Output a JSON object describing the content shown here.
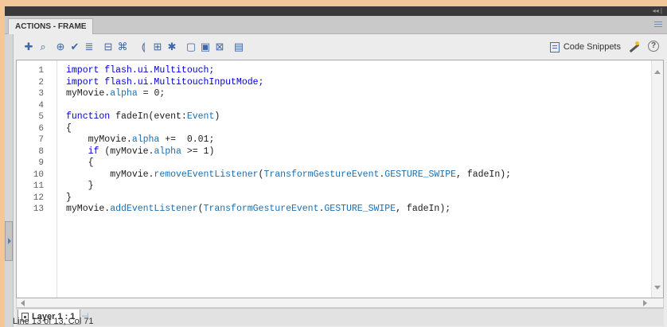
{
  "panel": {
    "tab_label": "ACTIONS - FRAME",
    "collapse_label": "◂◂ |"
  },
  "toolbar": {
    "icons": [
      "add-statement-icon",
      "find-icon",
      "target-path-icon",
      "check-syntax-icon",
      "auto-format-icon",
      "show-code-hint-icon",
      "debug-options-icon",
      "collapse-between-braces-icon",
      "collapse-selection-icon",
      "expand-all-icon",
      "apply-block-comment-icon",
      "apply-line-comment-icon",
      "remove-comment-icon",
      "show-hide-toolbox-icon"
    ],
    "code_snippets_label": "Code Snippets",
    "help_label": "?"
  },
  "editor": {
    "lines": [
      {
        "num": "1",
        "tokens": [
          {
            "t": "import flash.ui.Multitouch;",
            "c": "kw"
          }
        ]
      },
      {
        "num": "2",
        "tokens": [
          {
            "t": "import flash.ui.MultitouchInputMode;",
            "c": "kw"
          }
        ]
      },
      {
        "num": "3",
        "tokens": [
          {
            "t": "myMovie.",
            "c": "plain"
          },
          {
            "t": "alpha",
            "c": "fn"
          },
          {
            "t": " = 0;",
            "c": "plain"
          }
        ]
      },
      {
        "num": "4",
        "tokens": []
      },
      {
        "num": "5",
        "tokens": [
          {
            "t": "function",
            "c": "kw"
          },
          {
            "t": " fadeIn(event:",
            "c": "plain"
          },
          {
            "t": "Event",
            "c": "cls"
          },
          {
            "t": ")",
            "c": "plain"
          }
        ]
      },
      {
        "num": "6",
        "tokens": [
          {
            "t": "{",
            "c": "plain"
          }
        ]
      },
      {
        "num": "7",
        "tokens": [
          {
            "t": "    myMovie.",
            "c": "plain"
          },
          {
            "t": "alpha",
            "c": "fn"
          },
          {
            "t": " +=  0.01;",
            "c": "plain"
          }
        ]
      },
      {
        "num": "8",
        "tokens": [
          {
            "t": "    ",
            "c": "plain"
          },
          {
            "t": "if",
            "c": "kw"
          },
          {
            "t": " (myMovie.",
            "c": "plain"
          },
          {
            "t": "alpha",
            "c": "fn"
          },
          {
            "t": " >= 1)",
            "c": "plain"
          }
        ]
      },
      {
        "num": "9",
        "tokens": [
          {
            "t": "    {",
            "c": "plain"
          }
        ]
      },
      {
        "num": "10",
        "tokens": [
          {
            "t": "        myMovie.",
            "c": "plain"
          },
          {
            "t": "removeEventListener",
            "c": "fn"
          },
          {
            "t": "(",
            "c": "plain"
          },
          {
            "t": "TransformGestureEvent",
            "c": "cls"
          },
          {
            "t": ".",
            "c": "plain"
          },
          {
            "t": "GESTURE_SWIPE",
            "c": "cls"
          },
          {
            "t": ", fadeIn);",
            "c": "plain"
          }
        ]
      },
      {
        "num": "11",
        "tokens": [
          {
            "t": "    }",
            "c": "plain"
          }
        ]
      },
      {
        "num": "12",
        "tokens": [
          {
            "t": "}",
            "c": "plain"
          }
        ]
      },
      {
        "num": "13",
        "tokens": [
          {
            "t": "myMovie.",
            "c": "plain"
          },
          {
            "t": "addEventListener",
            "c": "fn"
          },
          {
            "t": "(",
            "c": "plain"
          },
          {
            "t": "TransformGestureEvent",
            "c": "cls"
          },
          {
            "t": ".",
            "c": "plain"
          },
          {
            "t": "GESTURE_SWIPE",
            "c": "cls"
          },
          {
            "t": ", fadeIn);",
            "c": "plain"
          }
        ]
      }
    ]
  },
  "layer_tab": {
    "label": "Layer 1 : 1"
  },
  "status": {
    "text": "Line 13 of 13, Col 71"
  }
}
